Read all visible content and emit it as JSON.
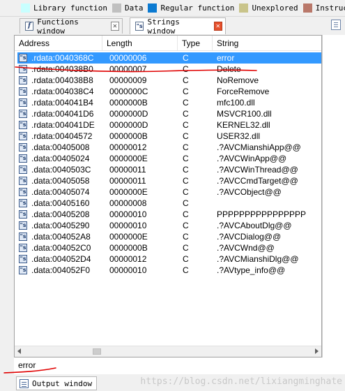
{
  "legend": [
    {
      "label": "Library function",
      "color": "#c8ffff",
      "icon": "color-swatch"
    },
    {
      "label": "Data",
      "color": "#c0c0c0",
      "icon": "color-swatch"
    },
    {
      "label": "Regular function",
      "color": "#0b7ad1",
      "icon": "color-swatch"
    },
    {
      "label": "Unexplored",
      "color": "#c9c48a",
      "icon": "color-swatch"
    },
    {
      "label": "Instruction",
      "color": "#b9786a",
      "icon": "color-swatch"
    }
  ],
  "tabs": [
    {
      "label": "Functions window",
      "icon": "function-icon",
      "active": false
    },
    {
      "label": "Strings window",
      "icon": "strings-icon",
      "active": true
    }
  ],
  "columns": [
    "Address",
    "Length",
    "Type",
    "String"
  ],
  "rows": [
    {
      "address": ".rdata:0040368C",
      "length": "00000006",
      "type": "C",
      "string": "error"
    },
    {
      "address": ".rdata:004038B0",
      "length": "00000007",
      "type": "C",
      "string": "Delete"
    },
    {
      "address": ".rdata:004038B8",
      "length": "00000009",
      "type": "C",
      "string": "NoRemove"
    },
    {
      "address": ".rdata:004038C4",
      "length": "0000000C",
      "type": "C",
      "string": "ForceRemove"
    },
    {
      "address": ".rdata:004041B4",
      "length": "0000000B",
      "type": "C",
      "string": "mfc100.dll"
    },
    {
      "address": ".rdata:004041D6",
      "length": "0000000D",
      "type": "C",
      "string": "MSVCR100.dll"
    },
    {
      "address": ".rdata:004041DE",
      "length": "0000000D",
      "type": "C",
      "string": "KERNEL32.dll"
    },
    {
      "address": ".rdata:00404572",
      "length": "0000000B",
      "type": "C",
      "string": "USER32.dll"
    },
    {
      "address": ".data:00405008",
      "length": "00000012",
      "type": "C",
      "string": ".?AVCMianshiApp@@"
    },
    {
      "address": ".data:00405024",
      "length": "0000000E",
      "type": "C",
      "string": ".?AVCWinApp@@"
    },
    {
      "address": ".data:0040503C",
      "length": "00000011",
      "type": "C",
      "string": ".?AVCWinThread@@"
    },
    {
      "address": ".data:00405058",
      "length": "00000011",
      "type": "C",
      "string": ".?AVCCmdTarget@@"
    },
    {
      "address": ".data:00405074",
      "length": "0000000E",
      "type": "C",
      "string": ".?AVCObject@@"
    },
    {
      "address": ".data:00405160",
      "length": "00000008",
      "type": "C",
      "string": ""
    },
    {
      "address": ".data:00405208",
      "length": "00000010",
      "type": "C",
      "string": "PPPPPPPPPPPPPPPP"
    },
    {
      "address": ".data:00405290",
      "length": "00000010",
      "type": "C",
      "string": ".?AVCAboutDlg@@"
    },
    {
      "address": ".data:004052A8",
      "length": "0000000E",
      "type": "C",
      "string": ".?AVCDialog@@"
    },
    {
      "address": ".data:004052C0",
      "length": "0000000B",
      "type": "C",
      "string": ".?AVCWnd@@"
    },
    {
      "address": ".data:004052D4",
      "length": "00000012",
      "type": "C",
      "string": ".?AVCMianshiDlg@@"
    },
    {
      "address": ".data:004052F0",
      "length": "00000010",
      "type": "C",
      "string": ".?AVtype_info@@"
    }
  ],
  "selected_row": 0,
  "output_line": "error",
  "output_tab": {
    "label": "Output window",
    "icon": "output-window-icon"
  },
  "string_row_icon": "string-icon",
  "watermark": "https://blog.csdn.net/lixiangminghate",
  "colors": {
    "selection": "#3399ff",
    "annotation": "#e00000",
    "active_close": "#e6502c"
  }
}
